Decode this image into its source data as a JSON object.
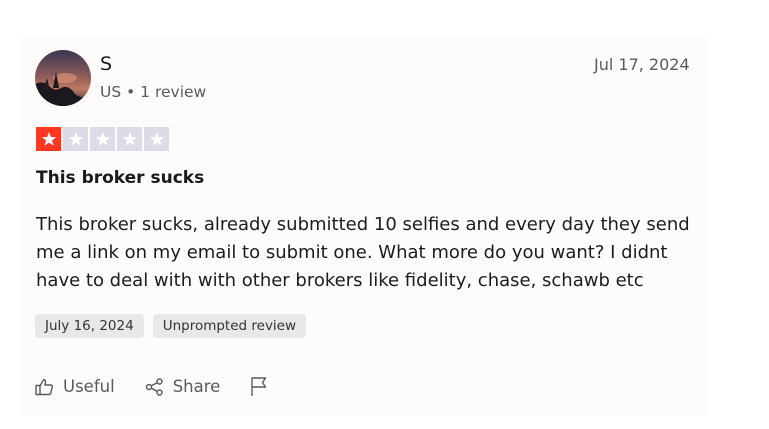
{
  "reviewer": {
    "name": "S",
    "meta": "US • 1 review"
  },
  "review": {
    "date": "Jul 17, 2024",
    "rating": 1,
    "rating_max": 5,
    "title": "This broker sucks",
    "body": "This broker sucks, already submitted 10 selfies and every day they send me a link on my email to submit one. What more do you want? I didnt have to deal with with other brokers like fidelity, chase, schawb etc",
    "tags": [
      "July 16, 2024",
      "Unprompted review"
    ]
  },
  "actions": {
    "useful_label": "Useful",
    "share_label": "Share",
    "useful_icon": "thumbs-up-icon",
    "share_icon": "share-icon",
    "report_icon": "flag-icon"
  },
  "colors": {
    "star_filled": "#ff3722",
    "star_empty": "#dcdce6",
    "tag_bg": "#e8e8e8",
    "muted_text": "#5b5b5b"
  }
}
